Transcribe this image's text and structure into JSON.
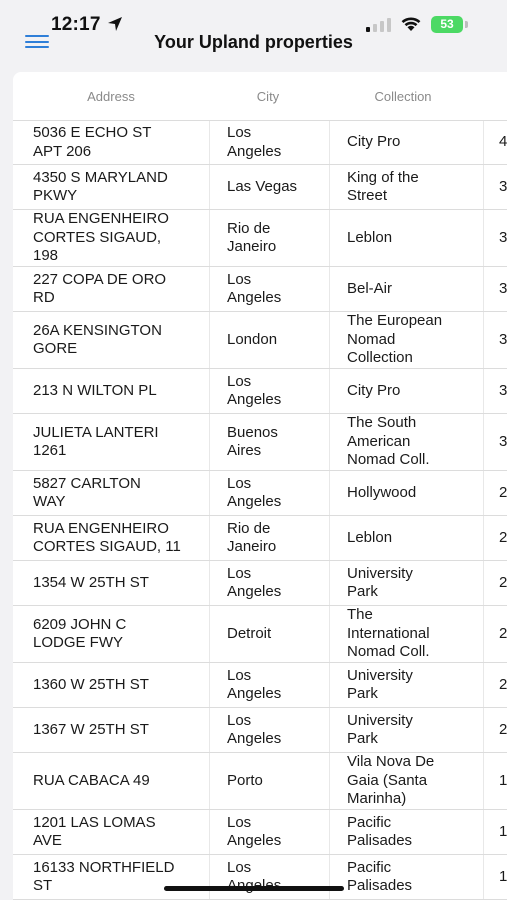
{
  "status": {
    "time": "12:17",
    "battery": "53"
  },
  "header": {
    "title": "Your Upland properties"
  },
  "table": {
    "columns": [
      "Address",
      "City",
      "Collection"
    ],
    "rows": [
      {
        "address": "5036 E ECHO ST\nAPT 206",
        "city": "Los\nAngeles",
        "collection": "City Pro",
        "extra": "4"
      },
      {
        "address": "4350 S MARYLAND\nPKWY",
        "city": "Las Vegas",
        "collection": "King of the\nStreet",
        "extra": "3"
      },
      {
        "address": "RUA ENGENHEIRO\nCORTES SIGAUD,\n198",
        "city": "Rio de\nJaneiro",
        "collection": "Leblon",
        "extra": "3"
      },
      {
        "address": "227 COPA DE ORO\nRD",
        "city": "Los\nAngeles",
        "collection": "Bel-Air",
        "extra": "3"
      },
      {
        "address": "26A KENSINGTON\nGORE",
        "city": "London",
        "collection": "The European\nNomad\nCollection",
        "extra": "3"
      },
      {
        "address": "213 N WILTON PL",
        "city": "Los\nAngeles",
        "collection": "City Pro",
        "extra": "3"
      },
      {
        "address": "JULIETA LANTERI\n1261",
        "city": "Buenos\nAires",
        "collection": "The South\nAmerican\nNomad Coll.",
        "extra": "3"
      },
      {
        "address": "5827 CARLTON\nWAY",
        "city": "Los\nAngeles",
        "collection": "Hollywood",
        "extra": "2"
      },
      {
        "address": "RUA ENGENHEIRO\nCORTES SIGAUD, 11",
        "city": "Rio de\nJaneiro",
        "collection": "Leblon",
        "extra": "2"
      },
      {
        "address": "1354 W 25TH ST",
        "city": "Los\nAngeles",
        "collection": "University\nPark",
        "extra": "2"
      },
      {
        "address": "6209 JOHN C\nLODGE FWY",
        "city": "Detroit",
        "collection": "The\nInternational\nNomad Coll.",
        "extra": "2"
      },
      {
        "address": "1360 W 25TH ST",
        "city": "Los\nAngeles",
        "collection": "University\nPark",
        "extra": "2"
      },
      {
        "address": "1367 W 25TH ST",
        "city": "Los\nAngeles",
        "collection": "University\nPark",
        "extra": "2"
      },
      {
        "address": "RUA CABACA 49",
        "city": "Porto",
        "collection": "Vila Nova De\nGaia (Santa\nMarinha)",
        "extra": "1"
      },
      {
        "address": "1201 LAS LOMAS\nAVE",
        "city": "Los\nAngeles",
        "collection": "Pacific\nPalisades",
        "extra": "1"
      },
      {
        "address": "16133 NORTHFIELD\nST",
        "city": "Los\nAngeles",
        "collection": "Pacific\nPalisades",
        "extra": "1"
      }
    ]
  }
}
